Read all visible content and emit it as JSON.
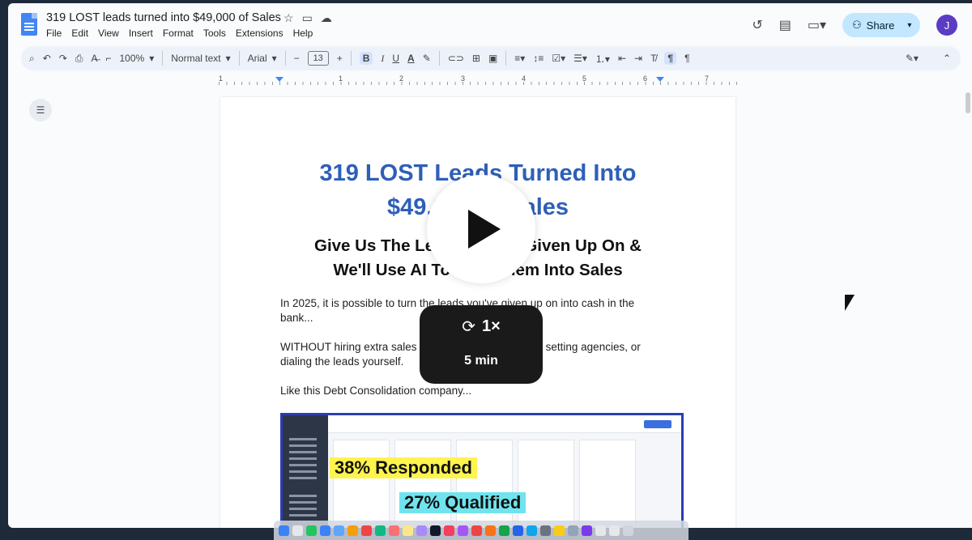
{
  "doc": {
    "title": "319 LOST leads turned into $49,000 of Sales",
    "menus": [
      "File",
      "Edit",
      "View",
      "Insert",
      "Format",
      "Tools",
      "Extensions",
      "Help"
    ],
    "share_label": "Share",
    "avatar_initial": "J"
  },
  "toolbar": {
    "zoom": "100%",
    "style": "Normal text",
    "font": "Arial",
    "font_size": "13",
    "bold": "B",
    "italic": "I",
    "underline": "U",
    "text_color": "A"
  },
  "ruler": {
    "numbers": [
      "1",
      "1",
      "2",
      "3",
      "4",
      "5",
      "6",
      "7"
    ]
  },
  "page": {
    "heading_line1": "319 LOST Leads Turned Into",
    "heading_line2": "$49,000 of Sales",
    "sub_line1": "Give Us The Leads You've Given Up On &",
    "sub_line2": "We'll Use AI To Turn Them Into Sales",
    "para1": "In 2025, it is possible to turn the leads you've given up on into cash in the bank...",
    "para2": "WITHOUT hiring extra sales reps, paying appointment setting agencies, or dialing the leads yourself.",
    "para3": "Like this Debt Consolidation company...",
    "highlight1": "38% Responded",
    "highlight2": "27% Qualified"
  },
  "video": {
    "speed": "1×",
    "duration": "5 min"
  },
  "colors": {
    "heading": "#2e5fb9",
    "share_bg": "#c2e7ff",
    "highlight_yellow": "#fff34d",
    "highlight_cyan": "#6fe4ee"
  }
}
